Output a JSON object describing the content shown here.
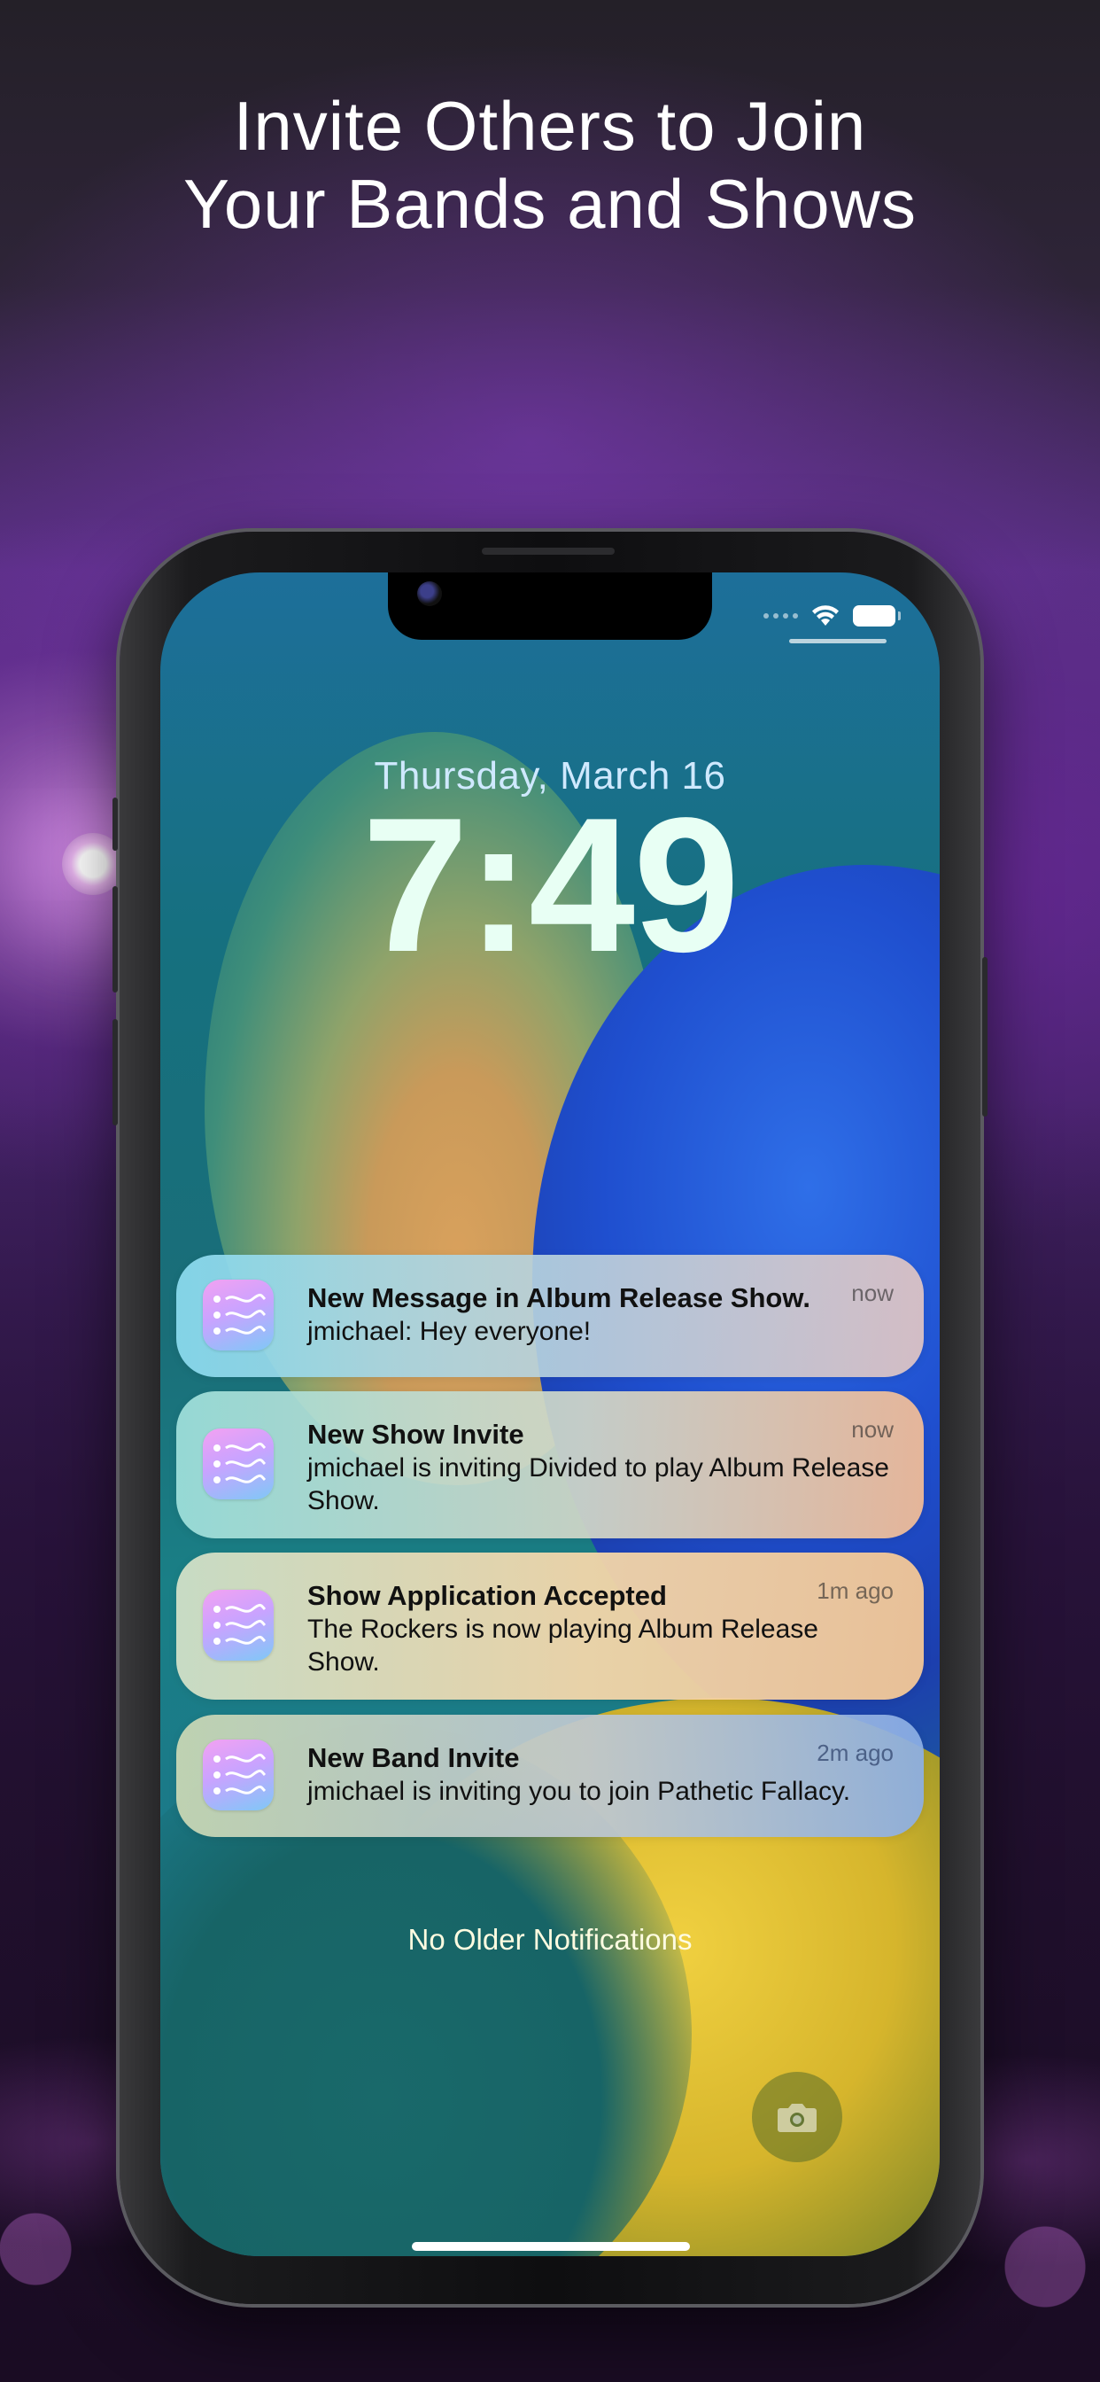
{
  "headline": {
    "line1": "Invite Others to Join",
    "line2": "Your Bands and Shows"
  },
  "lock_screen": {
    "date": "Thursday, March 16",
    "time": "7:49",
    "footer": "No Older Notifications"
  },
  "status_bar": {
    "icons": [
      "signal-dots-icon",
      "wifi-icon",
      "battery-icon"
    ]
  },
  "notifications": [
    {
      "title": "New Message in Album Release Show.",
      "body": "jmichael: Hey everyone!",
      "time": "now",
      "icon": "app-icon"
    },
    {
      "title": "New Show Invite",
      "body": "jmichael is inviting Divided to play Album Release Show.",
      "time": "now",
      "icon": "app-icon"
    },
    {
      "title": "Show Application Accepted",
      "body": "The Rockers is now playing Album Release Show.",
      "time": "1m ago",
      "icon": "app-icon"
    },
    {
      "title": "New Band Invite",
      "body": "jmichael is inviting you to join Pathetic Fallacy.",
      "time": "2m ago",
      "icon": "app-icon"
    }
  ],
  "colors": {
    "background": "#4a2672",
    "headline_text": "#ffffff",
    "time_text": "#e8fff4",
    "date_text": "#cfe9ff"
  }
}
